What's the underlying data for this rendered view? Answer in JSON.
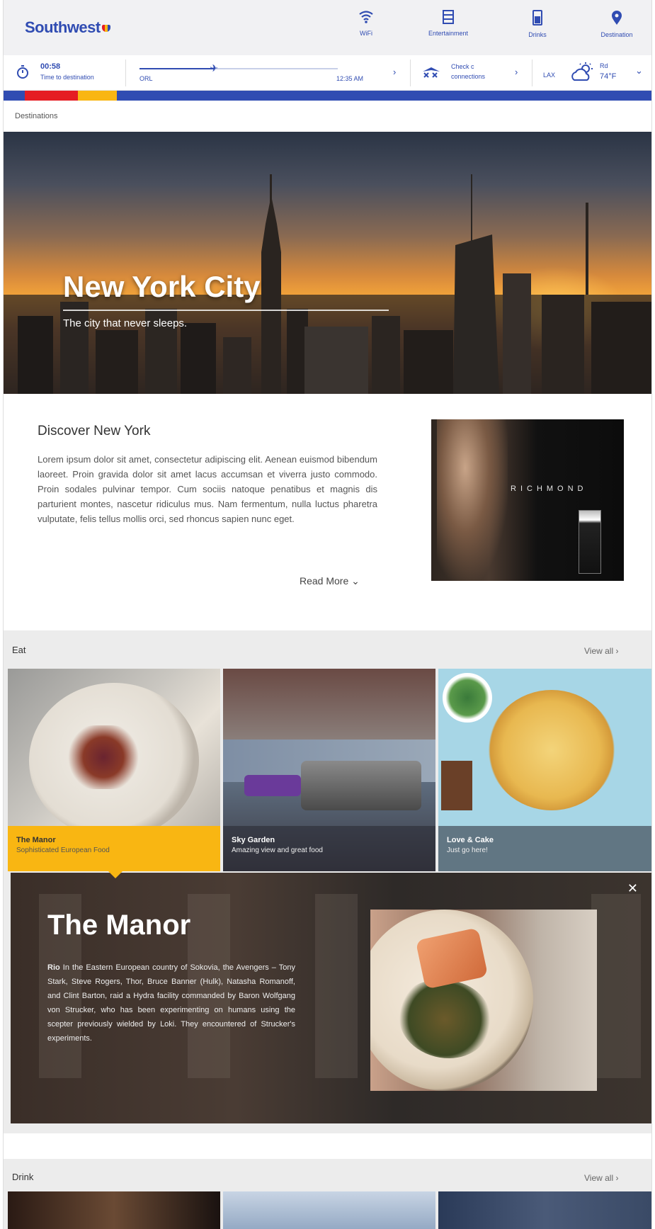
{
  "brand": {
    "name": "Southwest"
  },
  "nav": [
    {
      "label": "WiFi",
      "icon": "wifi-icon"
    },
    {
      "label": "Entertainment",
      "icon": "film-icon"
    },
    {
      "label": "Drinks",
      "icon": "cup-icon"
    },
    {
      "label": "Destination",
      "icon": "map-pin-icon"
    }
  ],
  "flight": {
    "time_remaining": "00:58",
    "time_label": "Time to destination",
    "origin": "ORL",
    "eta": "12:35 AM",
    "progress": 0.38,
    "connection_line1": "Check c",
    "connection_line2": "connections",
    "dest_city": "LAX",
    "weather_label": "Rd",
    "weather_temp": "74°F"
  },
  "breadcrumb": "Destinations",
  "hero": {
    "title": "New York City",
    "subtitle": "The city that never sleeps."
  },
  "discover": {
    "title": "Discover New York",
    "body": "Lorem ipsum dolor sit amet, consectetur adipiscing elit. Aenean euismod bibendum laoreet. Proin gravida dolor sit amet lacus accumsan et viverra justo commodo. Proin sodales pulvinar tempor. Cum sociis natoque penatibus et magnis dis parturient montes, nascetur ridiculus mus. Nam fermentum, nulla luctus pharetra vulputate, felis tellus mollis orci, sed rhoncus sapien nunc eget.",
    "read_more": "Read More",
    "ad_brand": "RICHMOND"
  },
  "eat": {
    "title": "Eat",
    "view_all": "View all",
    "tiles": [
      {
        "name": "The Manor",
        "desc": "Sophisticated European Food"
      },
      {
        "name": "Sky Garden",
        "desc": "Amazing view and great food"
      },
      {
        "name": "Love & Cake",
        "desc": "Just go here!"
      }
    ],
    "detail": {
      "title": "The Manor",
      "body_bold": "Rio",
      "body": " In the Eastern European country of Sokovia, the Avengers – Tony Stark, Steve Rogers, Thor, Bruce Banner (Hulk), Natasha Romanoff, and Clint Barton, raid a Hydra facility commanded by Baron Wolfgang von Strucker, who has been experimenting on humans using the scepter previously wielded by Loki. They encountered of Strucker's experiments."
    }
  },
  "drink": {
    "title": "Drink",
    "view_all": "View all"
  }
}
